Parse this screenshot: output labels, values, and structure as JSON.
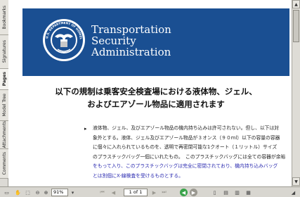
{
  "nav_tabs": [
    {
      "label": "Bookmarks"
    },
    {
      "label": "Signatures"
    },
    {
      "label": "Pages"
    },
    {
      "label": "Model Tree"
    },
    {
      "label": "Attachments"
    },
    {
      "label": "Comments"
    }
  ],
  "document": {
    "agency_lines": [
      "Transportation",
      "Security",
      "Administration"
    ],
    "seal_text": "U.S. DEPARTMENT OF HOMELAND SECURITY",
    "heading_line1": "以下の規制は乗客安全検査場における液体物、ジェル、",
    "heading_line2": "およびエアゾール物品に適用されます",
    "bullet_char": "▸",
    "paragraph_lines": [
      "液体物、ジェル、及びエアゾール物品の機内持ち込みは許可されない。但し、以下は対",
      "象外とする。液体、ジェル及びエアゾール物品が３オンス（９０ml）以下の容量の容器",
      "に個々に入れられているものを、透明で再密閉可能な1クオート（１リットル）サイズ",
      "のプラスチックバッグ一個にいれたもの。　このプラスチックバッグには全ての容器が余裕",
      "をもって入り、このプラスチックバッグは完全に密閉されており、機内持ち込みバッグ",
      "とは別個にX-線検査を受けるものとする。"
    ]
  },
  "statusbar": {
    "zoom": "91%",
    "page_indicator": "1 of 1"
  },
  "colors": {
    "banner": "#1a4f92",
    "nav_background": "#dcdad5",
    "status_background": "#d8d6d0"
  },
  "icons": [
    "hand-tool-icon",
    "select-tool-icon",
    "zoom-out-icon",
    "zoom-in-icon",
    "first-page-icon",
    "previous-page-icon",
    "next-page-icon",
    "last-page-icon",
    "go-back-icon",
    "go-forward-icon"
  ]
}
